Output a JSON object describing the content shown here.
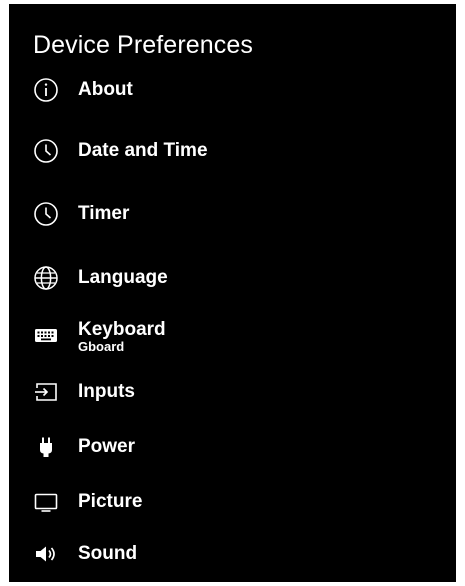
{
  "header": {
    "title": "Device Preferences"
  },
  "menu": {
    "items": [
      {
        "label": "About",
        "icon": "info-icon"
      },
      {
        "label": "Date and Time",
        "icon": "clock-icon"
      },
      {
        "label": "Timer",
        "icon": "clock-icon"
      },
      {
        "label": "Language",
        "icon": "globe-icon"
      },
      {
        "label": "Keyboard",
        "sublabel": "Gboard",
        "icon": "keyboard-icon"
      },
      {
        "label": "Inputs",
        "icon": "input-icon"
      },
      {
        "label": "Power",
        "icon": "plug-icon"
      },
      {
        "label": "Picture",
        "icon": "display-icon"
      },
      {
        "label": "Sound",
        "icon": "speaker-icon"
      }
    ]
  },
  "colors": {
    "background": "#000000",
    "text": "#ffffff",
    "frame": "#ffffff"
  }
}
